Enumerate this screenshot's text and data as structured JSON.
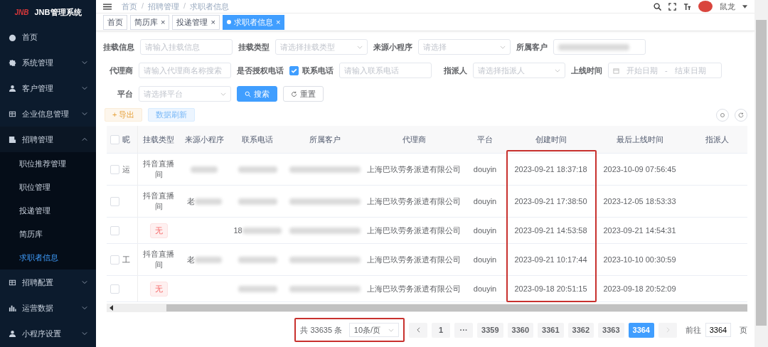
{
  "app": {
    "logo": "JNB",
    "title": "JNB管理系统"
  },
  "header": {
    "breadcrumb": [
      {
        "label": "首页",
        "separator": "/"
      },
      {
        "label": "招聘管理",
        "separator": "/"
      },
      {
        "label": "求职者信息"
      }
    ],
    "user": "鼠龙"
  },
  "sidebar": {
    "items": [
      {
        "label": "首页"
      },
      {
        "label": "系统管理",
        "expanded": false
      },
      {
        "label": "客户管理",
        "expanded": false
      },
      {
        "label": "企业信息管理",
        "expanded": false
      },
      {
        "label": "招聘管理",
        "expanded": true,
        "children": [
          {
            "label": "职位推荐管理",
            "selected": false
          },
          {
            "label": "职位管理",
            "selected": false
          },
          {
            "label": "投递管理",
            "selected": false
          },
          {
            "label": "简历库",
            "selected": false
          },
          {
            "label": "求职者信息",
            "selected": true
          }
        ]
      },
      {
        "label": "招聘配置",
        "expanded": false
      },
      {
        "label": "运营数据",
        "expanded": false
      },
      {
        "label": "小程序设置",
        "expanded": false
      }
    ]
  },
  "tags": [
    {
      "label": "首页",
      "selected": false
    },
    {
      "label": "简历库",
      "close": "×",
      "selected": false
    },
    {
      "label": "投递管理",
      "close": "×",
      "selected": false
    },
    {
      "label": "求职者信息",
      "close": "×",
      "selected": true
    }
  ],
  "filters": [
    [
      {
        "kind": "input",
        "label": "挂载信息",
        "placeholder": "请输入挂载信息"
      },
      {
        "kind": "select",
        "label": "挂载类型",
        "placeholder": "请选择挂载类型"
      },
      {
        "kind": "select",
        "label": "来源小程序",
        "placeholder": "请选择"
      },
      {
        "kind": "masked",
        "label": "所属客户"
      }
    ],
    [
      {
        "kind": "input",
        "label": "代理商",
        "placeholder": "请输入代理商名称搜索"
      },
      {
        "kind": "checkbox",
        "label": "是否授权电话",
        "option": "联系电话",
        "checked": true
      },
      {
        "kind": "input",
        "placeholder": "请输入联系电话"
      },
      {
        "kind": "select",
        "label": "指派人",
        "placeholder": "请选择指派人"
      },
      {
        "kind": "daterange",
        "label": "上线时间",
        "start": "开始日期",
        "separator": "-",
        "end": "结束日期"
      }
    ],
    [
      {
        "kind": "select",
        "label": "平台",
        "placeholder": "请选择平台"
      },
      {
        "kind": "search",
        "text": "搜索"
      },
      {
        "kind": "reset",
        "text": "重置"
      }
    ]
  ],
  "toolbar": {
    "export": "+ 导出",
    "refresh": "数据刷新"
  },
  "table": {
    "select_all_checked": false,
    "columns": [
      "昵",
      "挂载类型",
      "来源小程序",
      "联系电话",
      "所属客户",
      "代理商",
      "平台",
      "创建时间",
      "最后上线时间",
      "指派人"
    ],
    "rows": [
      {
        "checked": false,
        "nickname": "运",
        "mount": {
          "kind": "text",
          "text": "抖音直播间"
        },
        "source": {
          "masked": true
        },
        "phone": {
          "masked": true
        },
        "agent": "上海巴玖劳务派遣有限公司",
        "platform": "douyin",
        "created": "2023-09-21 18:37:18",
        "last_online": "2023-10-09 07:56:45"
      },
      {
        "checked": false,
        "mount": {
          "kind": "text",
          "text": "抖音直播间"
        },
        "source": {
          "prefix": "老",
          "masked": true
        },
        "phone": {
          "masked": true
        },
        "agent": "上海巴玖劳务派遣有限公司",
        "platform": "douyin",
        "created": "2023-09-21 17:38:50",
        "last_online": "2023-12-05 18:53:33"
      },
      {
        "checked": false,
        "mount": {
          "kind": "tag",
          "text": "无"
        },
        "source": {
          "masked": false
        },
        "phone": {
          "prefix": "18",
          "masked": true
        },
        "agent": "上海巴玖劳务派遣有限公司",
        "platform": "douyin",
        "created": "2023-09-21 14:53:58",
        "last_online": "2023-09-21 14:54:31"
      },
      {
        "checked": false,
        "nickname": "工",
        "mount": {
          "kind": "text",
          "text": "抖音直播间"
        },
        "source": {
          "prefix": "老",
          "masked": true
        },
        "phone": {
          "masked": true
        },
        "agent": "上海巴玖劳务派遣有限公司",
        "platform": "douyin",
        "created": "2023-09-21 10:17:44",
        "last_online": "2023-10-10 00:30:59"
      },
      {
        "checked": false,
        "mount": {
          "kind": "tag",
          "text": "无"
        },
        "source": {
          "masked": false
        },
        "phone": {
          "masked": true
        },
        "agent": "上海巴玖劳务派遣有限公司",
        "platform": "douyin",
        "created": "2023-09-18 20:51:15",
        "last_online": "2023-09-18 20:52:09"
      }
    ]
  },
  "pagination": {
    "total": "共 33635 条",
    "page_size": "10条/页",
    "pages": [
      {
        "label": "1",
        "selected": false
      },
      {
        "label": "···",
        "selected": false
      },
      {
        "label": "3359",
        "selected": false
      },
      {
        "label": "3360",
        "selected": false
      },
      {
        "label": "3361",
        "selected": false
      },
      {
        "label": "3362",
        "selected": false
      },
      {
        "label": "3363",
        "selected": false
      },
      {
        "label": "3364",
        "selected": true
      }
    ],
    "goto_label": "前往",
    "goto_value": "3364",
    "goto_suffix": "页"
  }
}
